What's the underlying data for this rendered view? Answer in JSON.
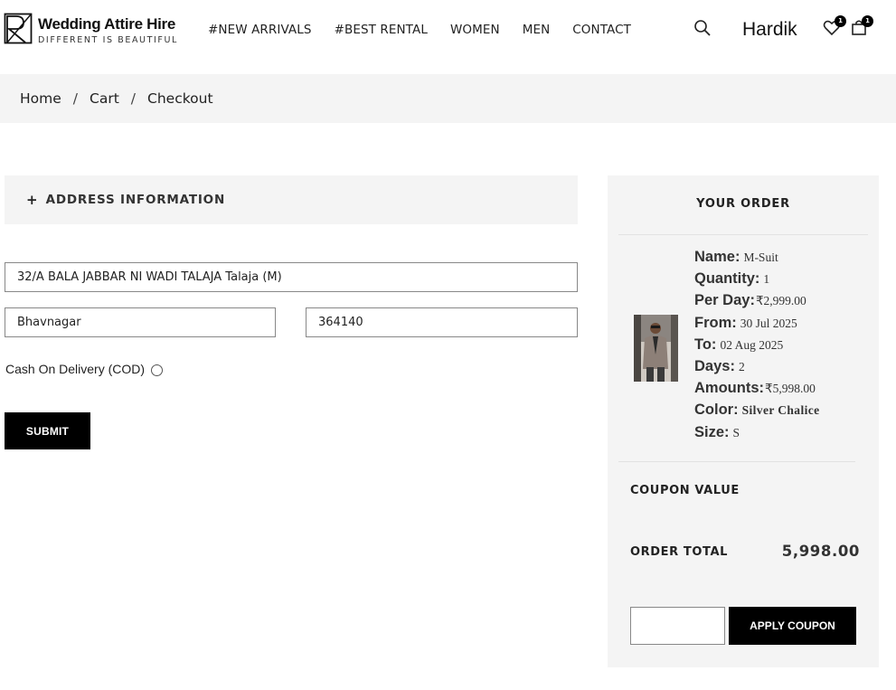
{
  "brand": {
    "name": "Wedding Attire Hire",
    "tagline": "DIFFERENT IS BEAUTIFUL"
  },
  "nav": {
    "items": [
      "#NEW ARRIVALS",
      "#BEST RENTAL",
      "WOMEN",
      "MEN",
      "CONTACT"
    ]
  },
  "header": {
    "user_name": "Hardik",
    "wishlist_count": "1",
    "cart_count": "1"
  },
  "breadcrumb": {
    "items": [
      "Home",
      "Cart",
      "Checkout"
    ],
    "separator": "/"
  },
  "address": {
    "section_toggle": "+",
    "section_title": "ADDRESS INFORMATION",
    "address_value": "32/A BALA JABBAR NI WADI TALAJA Talaja (M)",
    "city_value": "Bhavnagar",
    "pincode_value": "364140",
    "payment_label": "Cash On Delivery (COD)",
    "submit_label": "SUBMIT"
  },
  "order": {
    "title": "YOUR ORDER",
    "details": [
      {
        "label": "Name:",
        "value": "M-Suit"
      },
      {
        "label": "Quantity:",
        "value": "1"
      },
      {
        "label": "Per Day:",
        "value": "₹2,999.00"
      },
      {
        "label": "From:",
        "value": "30 Jul 2025"
      },
      {
        "label": "To:",
        "value": "02 Aug 2025"
      },
      {
        "label": "Days:",
        "value": "2"
      },
      {
        "label": "Amounts:",
        "value": "₹5,998.00"
      },
      {
        "label": "Color:",
        "value": "Silver Chalice"
      },
      {
        "label": "Size:",
        "value": "S"
      }
    ],
    "coupon_label": "COUPON VALUE",
    "total_label": "ORDER TOTAL",
    "total_value": "5,998.00",
    "coupon_placeholder": "",
    "apply_label": "APPLY COUPON"
  },
  "icons": {
    "search": "search-icon",
    "wishlist": "heart-icon",
    "cart": "shopping-bag-icon"
  },
  "colors": {
    "accent": "#000000",
    "panel_bg": "#f4f4f4"
  }
}
